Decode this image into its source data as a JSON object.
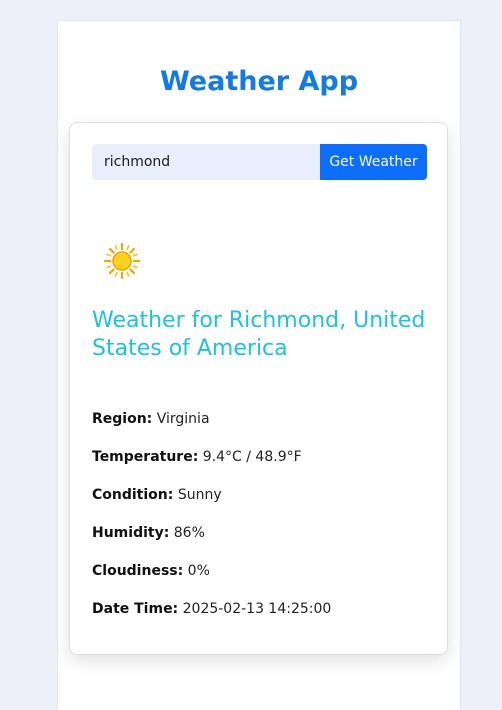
{
  "app": {
    "title": "Weather App"
  },
  "search": {
    "value": "richmond",
    "button_label": "Get Weather"
  },
  "weather": {
    "icon": "sun-icon",
    "heading": "Weather for Richmond, United States of America",
    "details": [
      {
        "label": "Region:",
        "value": "Virginia"
      },
      {
        "label": "Temperature:",
        "value": "9.4°C / 48.9°F"
      },
      {
        "label": "Condition:",
        "value": "Sunny"
      },
      {
        "label": "Humidity:",
        "value": "86%"
      },
      {
        "label": "Cloudiness:",
        "value": "0%"
      },
      {
        "label": "Date Time:",
        "value": "2025-02-13 14:25:00"
      }
    ]
  },
  "colors": {
    "title": "#0f7ae8",
    "button": "#0d6efd",
    "heading": "#1cc2e4",
    "background": "#edf0f8"
  }
}
